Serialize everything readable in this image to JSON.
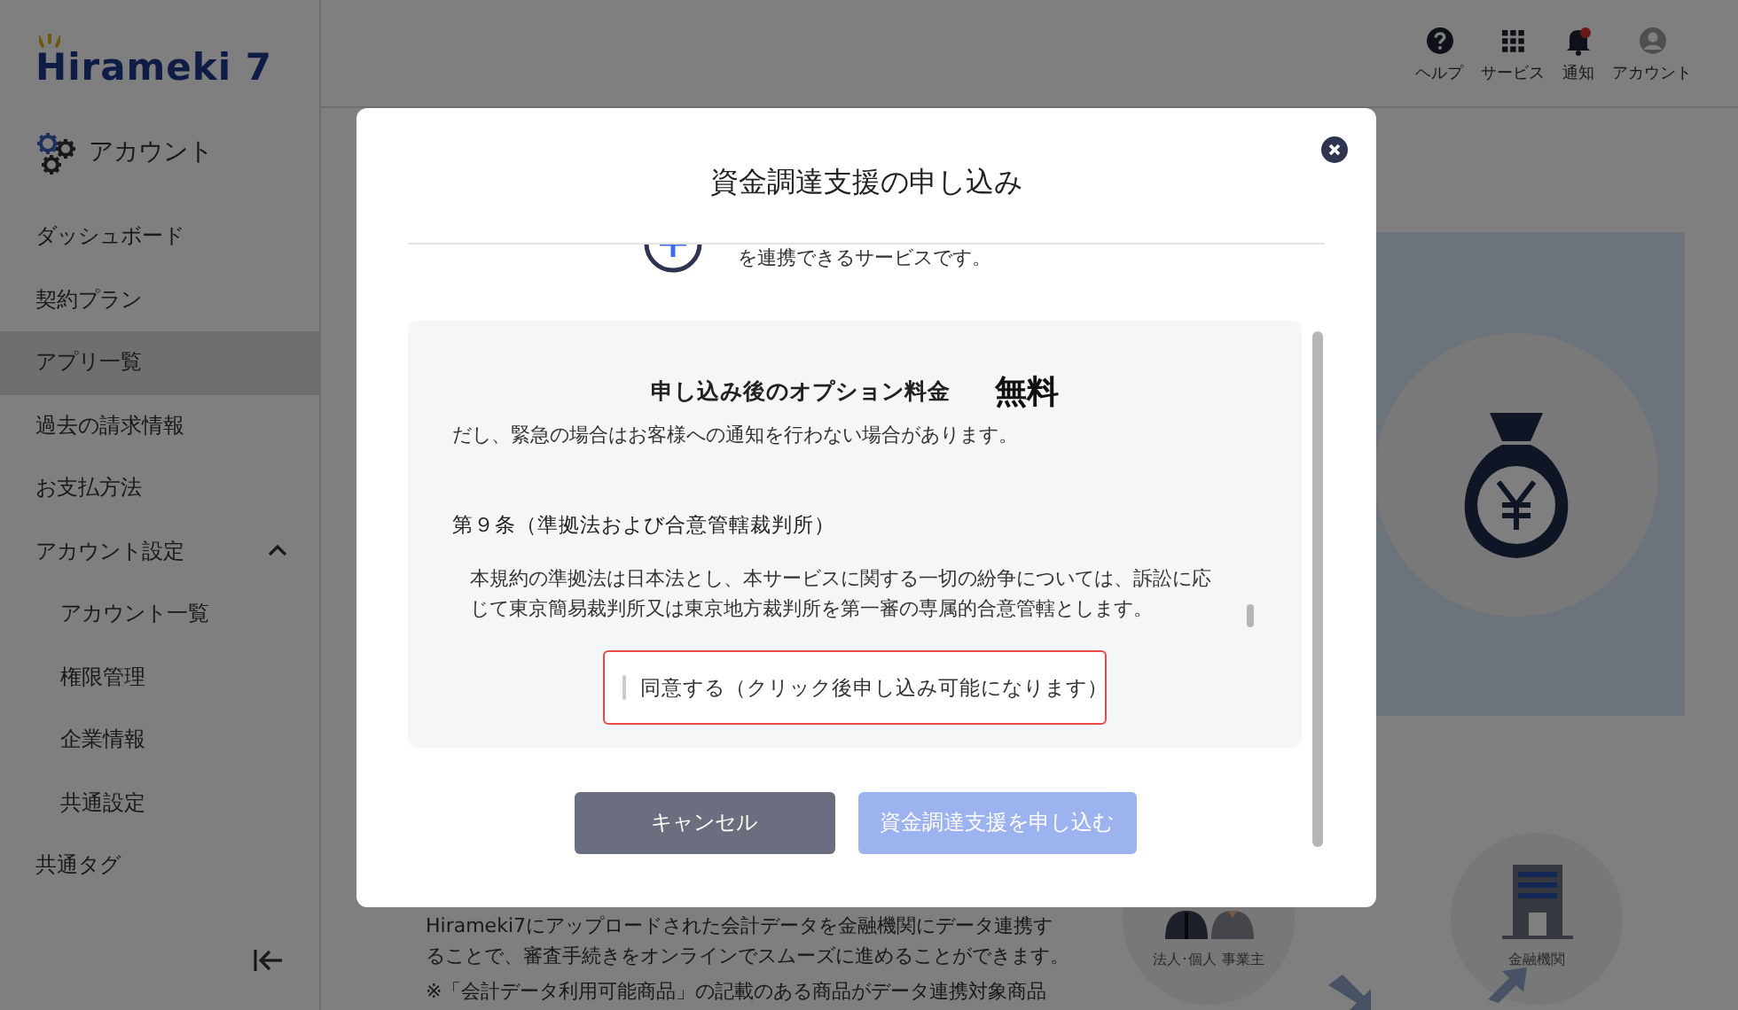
{
  "logo": {
    "text": "Hirameki 7"
  },
  "sidebar": {
    "section": "アカウント",
    "items": [
      {
        "label": "ダッシュボード",
        "selected": false
      },
      {
        "label": "契約プラン",
        "selected": false
      },
      {
        "label": "アプリ一覧",
        "selected": true
      },
      {
        "label": "過去の請求情報",
        "selected": false
      },
      {
        "label": "お支払方法",
        "selected": false
      },
      {
        "label": "アカウント設定",
        "selected": false,
        "expanded": true,
        "children": [
          {
            "label": "アカウント一覧",
            "selected": false
          },
          {
            "label": "権限管理",
            "selected": false
          },
          {
            "label": "企業情報",
            "selected": false
          },
          {
            "label": "共通設定",
            "selected": false
          }
        ]
      },
      {
        "label": "共通タグ",
        "selected": false
      }
    ]
  },
  "header": {
    "actions": [
      {
        "label": "ヘルプ",
        "kind": "help",
        "unread": false
      },
      {
        "label": "サービス",
        "kind": "apps",
        "unread": false
      },
      {
        "label": "通知",
        "kind": "bell",
        "unread": true
      },
      {
        "label": "アカウント",
        "kind": "account",
        "unread": false
      }
    ]
  },
  "background": {
    "description": [
      "Hirameki7にアップロードされた会計データを金融機関にデータ連携す",
      "ることで、審査手続きをオンラインでスムーズに進めることができます。"
    ],
    "note": "※「会計データ利用可能商品」の記載のある商品がデータ連携対象商品",
    "parties": [
      {
        "label": "法人･個人 事業主",
        "kind": "people"
      },
      {
        "label": "金融機関",
        "kind": "bank"
      }
    ]
  },
  "modal": {
    "title": "資金調達支援の申し込み",
    "intro": "を連携できるサービスです。",
    "fee": {
      "label": "申し込み後のオプション料金",
      "value": "無料"
    },
    "terms": {
      "clipped_line": "だし、緊急の場合はお客様への通知を行わない場合があります。",
      "article_title": "第９条（準拠法および合意管轄裁判所）",
      "article_body": "本規約の準拠法は日本法とし、本サービスに関する一切の紛争については、訴訟に応じて東京簡易裁判所又は東京地方裁判所を第一審の専属的合意管轄とします。"
    },
    "agree": {
      "label": "同意する（クリック後申し込み可能になります）",
      "checked": false
    },
    "buttons": [
      {
        "label": "キャンセル",
        "kind": "cancel",
        "disabled": false
      },
      {
        "label": "資金調達支援を申し込む",
        "kind": "submit",
        "disabled": true
      }
    ]
  }
}
